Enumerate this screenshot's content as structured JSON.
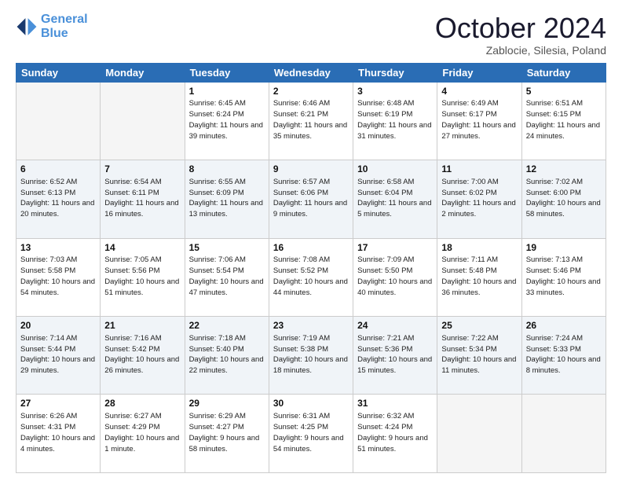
{
  "header": {
    "logo_line1": "General",
    "logo_line2": "Blue",
    "month": "October 2024",
    "location": "Zablocie, Silesia, Poland"
  },
  "days_of_week": [
    "Sunday",
    "Monday",
    "Tuesday",
    "Wednesday",
    "Thursday",
    "Friday",
    "Saturday"
  ],
  "weeks": [
    [
      {
        "day": "",
        "sunrise": "",
        "sunset": "",
        "daylight": ""
      },
      {
        "day": "",
        "sunrise": "",
        "sunset": "",
        "daylight": ""
      },
      {
        "day": "1",
        "sunrise": "Sunrise: 6:45 AM",
        "sunset": "Sunset: 6:24 PM",
        "daylight": "Daylight: 11 hours and 39 minutes."
      },
      {
        "day": "2",
        "sunrise": "Sunrise: 6:46 AM",
        "sunset": "Sunset: 6:21 PM",
        "daylight": "Daylight: 11 hours and 35 minutes."
      },
      {
        "day": "3",
        "sunrise": "Sunrise: 6:48 AM",
        "sunset": "Sunset: 6:19 PM",
        "daylight": "Daylight: 11 hours and 31 minutes."
      },
      {
        "day": "4",
        "sunrise": "Sunrise: 6:49 AM",
        "sunset": "Sunset: 6:17 PM",
        "daylight": "Daylight: 11 hours and 27 minutes."
      },
      {
        "day": "5",
        "sunrise": "Sunrise: 6:51 AM",
        "sunset": "Sunset: 6:15 PM",
        "daylight": "Daylight: 11 hours and 24 minutes."
      }
    ],
    [
      {
        "day": "6",
        "sunrise": "Sunrise: 6:52 AM",
        "sunset": "Sunset: 6:13 PM",
        "daylight": "Daylight: 11 hours and 20 minutes."
      },
      {
        "day": "7",
        "sunrise": "Sunrise: 6:54 AM",
        "sunset": "Sunset: 6:11 PM",
        "daylight": "Daylight: 11 hours and 16 minutes."
      },
      {
        "day": "8",
        "sunrise": "Sunrise: 6:55 AM",
        "sunset": "Sunset: 6:09 PM",
        "daylight": "Daylight: 11 hours and 13 minutes."
      },
      {
        "day": "9",
        "sunrise": "Sunrise: 6:57 AM",
        "sunset": "Sunset: 6:06 PM",
        "daylight": "Daylight: 11 hours and 9 minutes."
      },
      {
        "day": "10",
        "sunrise": "Sunrise: 6:58 AM",
        "sunset": "Sunset: 6:04 PM",
        "daylight": "Daylight: 11 hours and 5 minutes."
      },
      {
        "day": "11",
        "sunrise": "Sunrise: 7:00 AM",
        "sunset": "Sunset: 6:02 PM",
        "daylight": "Daylight: 11 hours and 2 minutes."
      },
      {
        "day": "12",
        "sunrise": "Sunrise: 7:02 AM",
        "sunset": "Sunset: 6:00 PM",
        "daylight": "Daylight: 10 hours and 58 minutes."
      }
    ],
    [
      {
        "day": "13",
        "sunrise": "Sunrise: 7:03 AM",
        "sunset": "Sunset: 5:58 PM",
        "daylight": "Daylight: 10 hours and 54 minutes."
      },
      {
        "day": "14",
        "sunrise": "Sunrise: 7:05 AM",
        "sunset": "Sunset: 5:56 PM",
        "daylight": "Daylight: 10 hours and 51 minutes."
      },
      {
        "day": "15",
        "sunrise": "Sunrise: 7:06 AM",
        "sunset": "Sunset: 5:54 PM",
        "daylight": "Daylight: 10 hours and 47 minutes."
      },
      {
        "day": "16",
        "sunrise": "Sunrise: 7:08 AM",
        "sunset": "Sunset: 5:52 PM",
        "daylight": "Daylight: 10 hours and 44 minutes."
      },
      {
        "day": "17",
        "sunrise": "Sunrise: 7:09 AM",
        "sunset": "Sunset: 5:50 PM",
        "daylight": "Daylight: 10 hours and 40 minutes."
      },
      {
        "day": "18",
        "sunrise": "Sunrise: 7:11 AM",
        "sunset": "Sunset: 5:48 PM",
        "daylight": "Daylight: 10 hours and 36 minutes."
      },
      {
        "day": "19",
        "sunrise": "Sunrise: 7:13 AM",
        "sunset": "Sunset: 5:46 PM",
        "daylight": "Daylight: 10 hours and 33 minutes."
      }
    ],
    [
      {
        "day": "20",
        "sunrise": "Sunrise: 7:14 AM",
        "sunset": "Sunset: 5:44 PM",
        "daylight": "Daylight: 10 hours and 29 minutes."
      },
      {
        "day": "21",
        "sunrise": "Sunrise: 7:16 AM",
        "sunset": "Sunset: 5:42 PM",
        "daylight": "Daylight: 10 hours and 26 minutes."
      },
      {
        "day": "22",
        "sunrise": "Sunrise: 7:18 AM",
        "sunset": "Sunset: 5:40 PM",
        "daylight": "Daylight: 10 hours and 22 minutes."
      },
      {
        "day": "23",
        "sunrise": "Sunrise: 7:19 AM",
        "sunset": "Sunset: 5:38 PM",
        "daylight": "Daylight: 10 hours and 18 minutes."
      },
      {
        "day": "24",
        "sunrise": "Sunrise: 7:21 AM",
        "sunset": "Sunset: 5:36 PM",
        "daylight": "Daylight: 10 hours and 15 minutes."
      },
      {
        "day": "25",
        "sunrise": "Sunrise: 7:22 AM",
        "sunset": "Sunset: 5:34 PM",
        "daylight": "Daylight: 10 hours and 11 minutes."
      },
      {
        "day": "26",
        "sunrise": "Sunrise: 7:24 AM",
        "sunset": "Sunset: 5:33 PM",
        "daylight": "Daylight: 10 hours and 8 minutes."
      }
    ],
    [
      {
        "day": "27",
        "sunrise": "Sunrise: 6:26 AM",
        "sunset": "Sunset: 4:31 PM",
        "daylight": "Daylight: 10 hours and 4 minutes."
      },
      {
        "day": "28",
        "sunrise": "Sunrise: 6:27 AM",
        "sunset": "Sunset: 4:29 PM",
        "daylight": "Daylight: 10 hours and 1 minute."
      },
      {
        "day": "29",
        "sunrise": "Sunrise: 6:29 AM",
        "sunset": "Sunset: 4:27 PM",
        "daylight": "Daylight: 9 hours and 58 minutes."
      },
      {
        "day": "30",
        "sunrise": "Sunrise: 6:31 AM",
        "sunset": "Sunset: 4:25 PM",
        "daylight": "Daylight: 9 hours and 54 minutes."
      },
      {
        "day": "31",
        "sunrise": "Sunrise: 6:32 AM",
        "sunset": "Sunset: 4:24 PM",
        "daylight": "Daylight: 9 hours and 51 minutes."
      },
      {
        "day": "",
        "sunrise": "",
        "sunset": "",
        "daylight": ""
      },
      {
        "day": "",
        "sunrise": "",
        "sunset": "",
        "daylight": ""
      }
    ]
  ]
}
